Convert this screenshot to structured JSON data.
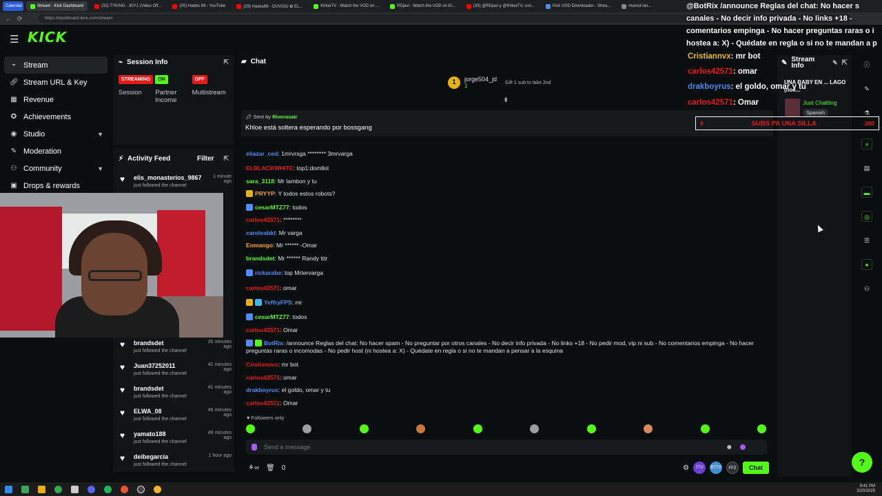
{
  "browser": {
    "tabs": [
      {
        "label": "Calendar",
        "color": "#ffffff"
      },
      {
        "label": "Stream - Kick Dashboard",
        "color": "#53fc18"
      },
      {
        "label": "(32) TYKING - 30Y1 (Video Off...",
        "color": "#ff0000"
      },
      {
        "label": "(30) Hades 66 - YouTube",
        "color": "#ff0000"
      },
      {
        "label": "(29) Hades66 - OUVIOU ✿ EL...",
        "color": "#ff0000"
      },
      {
        "label": "KhloeTV - Watch the VOD on ...",
        "color": "#53fc18"
      },
      {
        "label": "RDjavi - Watch the VOD on Ki...",
        "color": "#53fc18"
      },
      {
        "label": "(33) @RDjavi y @KhloeTV, con...",
        "color": "#ff0000"
      },
      {
        "label": "Kick VOD Downloader - Strea...",
        "color": "#4a90e2"
      },
      {
        "label": "mamut lan...",
        "color": "#888888"
      }
    ],
    "url": "https://dashboard.kick.com/stream"
  },
  "nav": {
    "logo": "KICK",
    "items": [
      {
        "label": "Stream",
        "icon": "pulse-icon"
      },
      {
        "label": "Stream URL & Key",
        "icon": "link-icon"
      },
      {
        "label": "Revenue",
        "icon": "revenue-icon"
      },
      {
        "label": "Achievements",
        "icon": "star-icon"
      },
      {
        "label": "Studio",
        "icon": "studio-icon"
      },
      {
        "label": "Moderation",
        "icon": "wrench-icon"
      },
      {
        "label": "Community",
        "icon": "community-icon"
      },
      {
        "label": "Drops & rewards",
        "icon": "gift-icon"
      }
    ]
  },
  "session": {
    "title": "Session Info",
    "streaming": "STREAMING",
    "session_label": "Session",
    "on": "ON",
    "partner_label": "Partner Income",
    "off": "OFF",
    "multistream_label": "Multistream"
  },
  "activity": {
    "title": "Activity Feed",
    "filter": "Filter",
    "items": [
      {
        "user": "elis_monasterios_9867",
        "time": "1 minute ago",
        "text": "just followed the channel"
      },
      {
        "user": "brandsdet",
        "time": "35 minutes ago",
        "text": "just followed the channel"
      },
      {
        "user": "Juan37252011",
        "time": "41 minutes ago",
        "text": "just followed the channel"
      },
      {
        "user": "brandsdet",
        "time": "41 minutes ago",
        "text": "just followed the channel"
      },
      {
        "user": "ELWA_08",
        "time": "46 minutes ago",
        "text": "just followed the channel"
      },
      {
        "user": "yamato188",
        "time": "49 minutes ago",
        "text": "just followed the channel"
      },
      {
        "user": "deibegarcia",
        "time": "1 hour ago",
        "text": "just followed the channel"
      }
    ]
  },
  "chat": {
    "title": "Chat",
    "gifter": {
      "name": "jorge504_jd",
      "count": "1"
    },
    "gift_hint": "Gift 1 sub to take 2nd",
    "pinned": {
      "sent_by_prefix": "Sent by",
      "sent_by_user": "Riverasair",
      "message": "Khloe está soltera esperando por bossgang"
    },
    "messages": [
      {
        "user": "eliazar_ced",
        "color": "#4f8cf7",
        "text": "1mrvrsga  ******** 3mrvarga"
      },
      {
        "user": "ELBLACKWHITE",
        "color": "#e91916",
        "text": "top1:domllol"
      },
      {
        "user": "sara_3118",
        "color": "#53fc18",
        "text": "Mr lambon y tu"
      },
      {
        "user": "PRYYP",
        "color": "#f5a623",
        "text": "Y todos estos robots?"
      },
      {
        "user": "cesarMTZ77",
        "color": "#53fc18",
        "text": "todos"
      },
      {
        "user": "carlos42571",
        "color": "#e91916",
        "text": "********"
      },
      {
        "user": "careteabkt",
        "color": "#4f8cf7",
        "text": "Mr varga"
      },
      {
        "user": "Enmango",
        "color": "#f5a623",
        "text": "Mr ****** -Omar"
      },
      {
        "user": "brandsdet",
        "color": "#53fc18",
        "text": "Mr ****** Randy tttr"
      },
      {
        "user": "rickarabe",
        "color": "#4f8cf7",
        "text": "top   Mrtervarga"
      },
      {
        "user": "carlos42571",
        "color": "#e91916",
        "text": "omar"
      },
      {
        "user": "YeffryFPS",
        "color": "#4f8cf7",
        "text": "mr"
      },
      {
        "user": "cesarMTZ77",
        "color": "#53fc18",
        "text": "todos"
      },
      {
        "user": "carlos42571",
        "color": "#e91916",
        "text": "Omar"
      },
      {
        "user": "BotRix",
        "color": "#4f8cf7",
        "text": "/announce Reglas del chat: No hacer spam - No preguntar por otros canales - No decir info privada - No links +18 - No pedir mod, vip ni sub - No comentarios empinga - No hacer preguntas raras o incomodas - No pedir host (ni hostea a: X) - Quédate en regla o si no te mandan a pensar a la esquina"
      },
      {
        "user": "Cristiannvx",
        "color": "#e91916",
        "text": "mr bot"
      },
      {
        "user": "carlos42571",
        "color": "#e91916",
        "text": "omar"
      },
      {
        "user": "drakboyrus",
        "color": "#4f8cf7",
        "text": "el goldo, omar y tu"
      },
      {
        "user": "carlos42571",
        "color": "#e91916",
        "text": "Omar"
      }
    ],
    "followers_only": "Followers only",
    "input_placeholder": "Send a message",
    "footer_count": "0",
    "chat_button": "Chat",
    "badge_7tv": "7TV",
    "badge_bttv": "BTTV",
    "badge_ffz": "FFZ"
  },
  "stream_info": {
    "title": "Stream Info",
    "stream_title": "UNA BABY EN ... LAGO (nos...",
    "category": "Just Chatting",
    "language": "Spanish"
  },
  "overlay": {
    "announce": "@BotRix /announce Reglas del chat: No hacer s canales - No decir info privada - No links +18 - comentarios empinga - No hacer preguntas raras o i hostea a: X) - Quédate en regla o si no te mandan a p",
    "lines": [
      {
        "user": "Cristiannvx",
        "color": "#e8c21a",
        "text": ": mr bot"
      },
      {
        "user": "carlos42571",
        "color": "#e91916",
        "text": ": omar"
      },
      {
        "user": "drakboyrus",
        "color": "#4f8cf7",
        "text": ": el goldo, omar y tu"
      },
      {
        "user": "carlos42571",
        "color": "#e91916",
        "text": ": Omar"
      }
    ],
    "sub_count": "0",
    "sub_goal": "SUBS PA UNA SILLA",
    "sub_target": "200"
  },
  "taskbar": {
    "time": "9:41 PM",
    "date": "3/20/2025"
  }
}
